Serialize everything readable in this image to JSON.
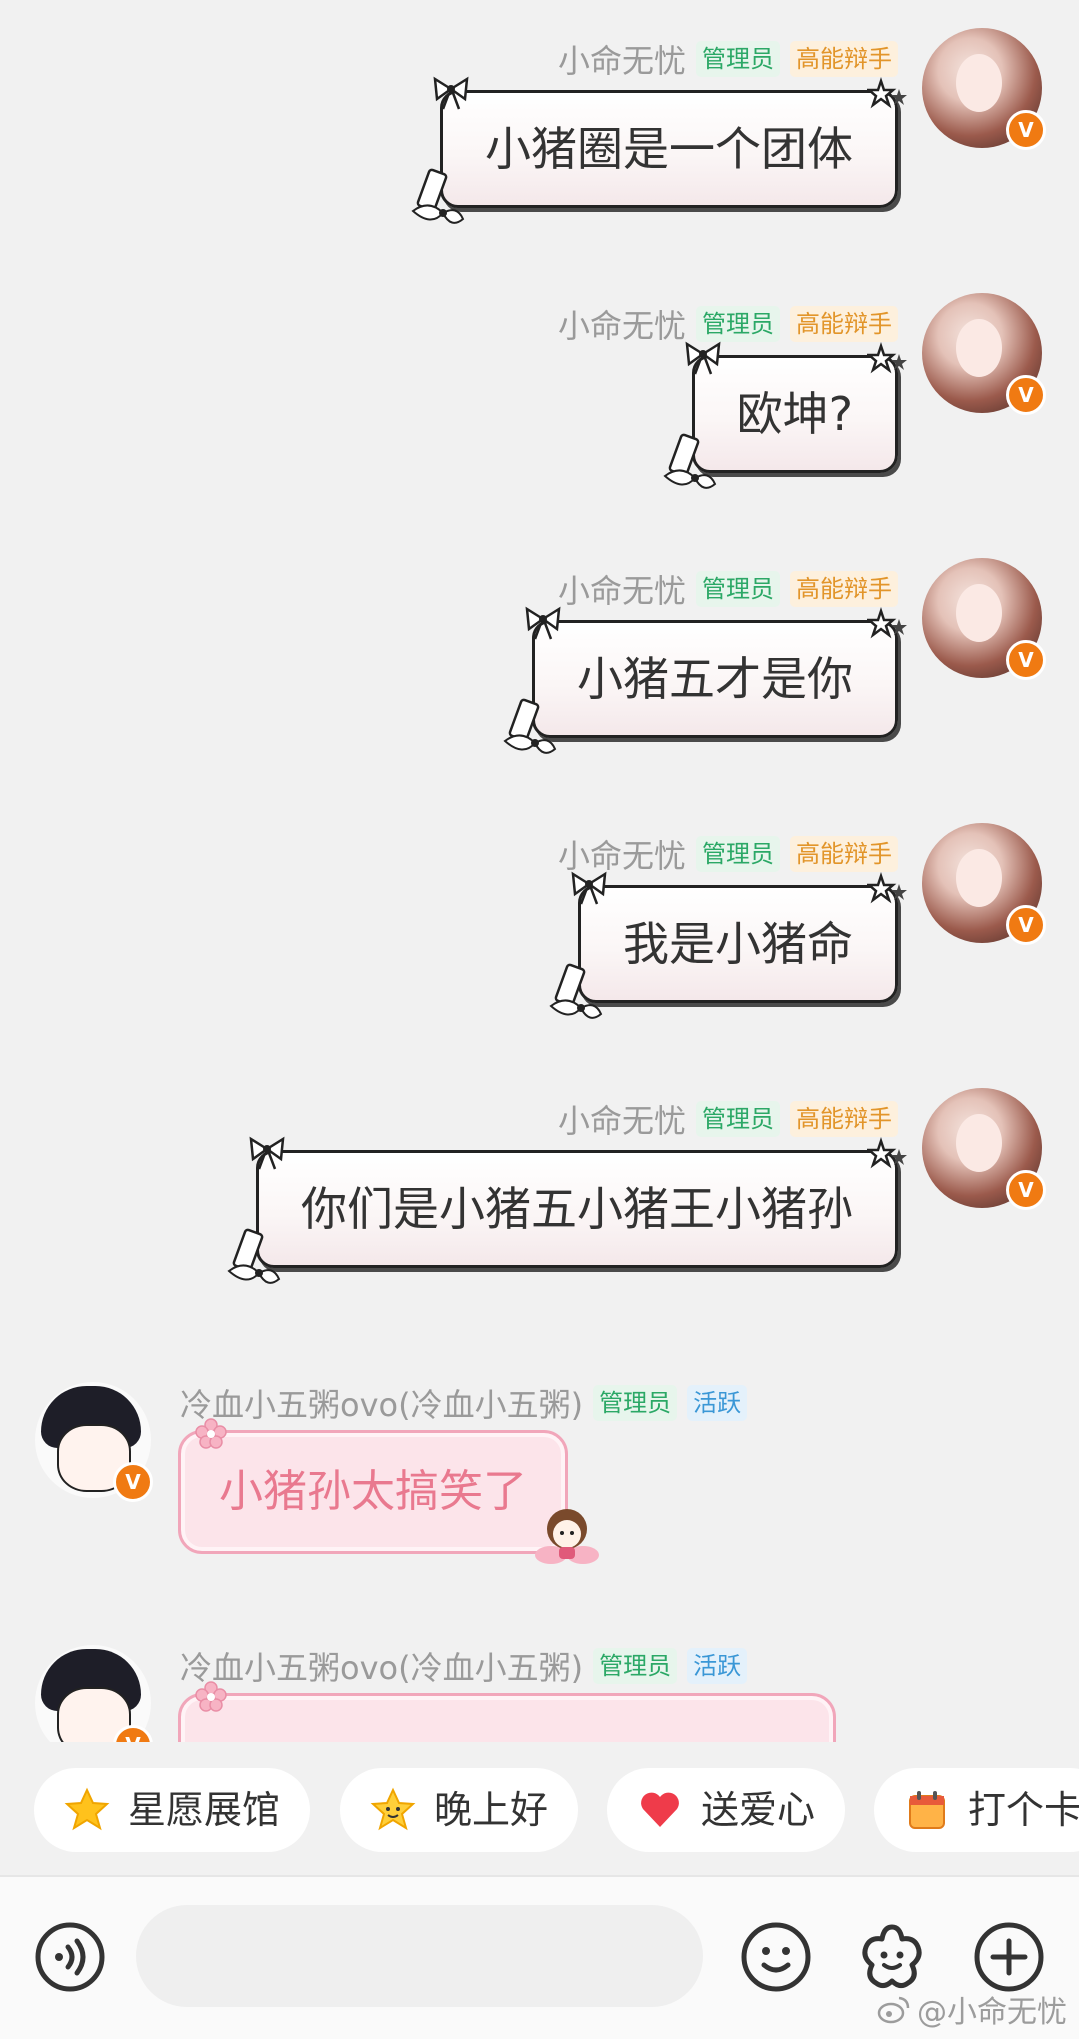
{
  "chat": {
    "messages_right": [
      {
        "username": "小命无忧",
        "tag_admin": "管理员",
        "tag_title": "高能辩手",
        "text": "小猪圈是一个团体"
      },
      {
        "username": "小命无忧",
        "tag_admin": "管理员",
        "tag_title": "高能辩手",
        "text": "欧坤?"
      },
      {
        "username": "小命无忧",
        "tag_admin": "管理员",
        "tag_title": "高能辩手",
        "text": "小猪五才是你"
      },
      {
        "username": "小命无忧",
        "tag_admin": "管理员",
        "tag_title": "高能辩手",
        "text": "我是小猪命"
      },
      {
        "username": "小命无忧",
        "tag_admin": "管理员",
        "tag_title": "高能辩手",
        "text": "你们是小猪五小猪王小猪孙"
      }
    ],
    "messages_left": [
      {
        "username": "冷血小五粥ovo(冷血小五粥)",
        "tag_admin": "管理员",
        "tag_active": "活跃",
        "text": "小猪孙太搞笑了"
      },
      {
        "username": "冷血小五粥ovo(冷血小五粥)",
        "tag_admin": "管理员",
        "tag_active": "活跃",
        "text": ""
      }
    ],
    "verified_mark": "V"
  },
  "quick_replies": [
    {
      "label": "星愿展馆",
      "icon": "star-icon"
    },
    {
      "label": "晚上好",
      "icon": "smiling-star-icon"
    },
    {
      "label": "送爱心",
      "icon": "heart-icon"
    },
    {
      "label": "打个卡",
      "icon": "calendar-icon"
    }
  ],
  "input_bar": {
    "placeholder": "",
    "icons": [
      "voice-icon",
      "emoji-icon",
      "sticker-icon",
      "plus-icon"
    ]
  },
  "watermark": "@小命无忧",
  "colors": {
    "background": "#f1f1f1",
    "admin_tag": "#2ba866",
    "title_tag": "#e2952a",
    "active_tag": "#3a97d6",
    "pink_bubble_text": "#e9798f",
    "verified_badge": "#f07a12"
  }
}
